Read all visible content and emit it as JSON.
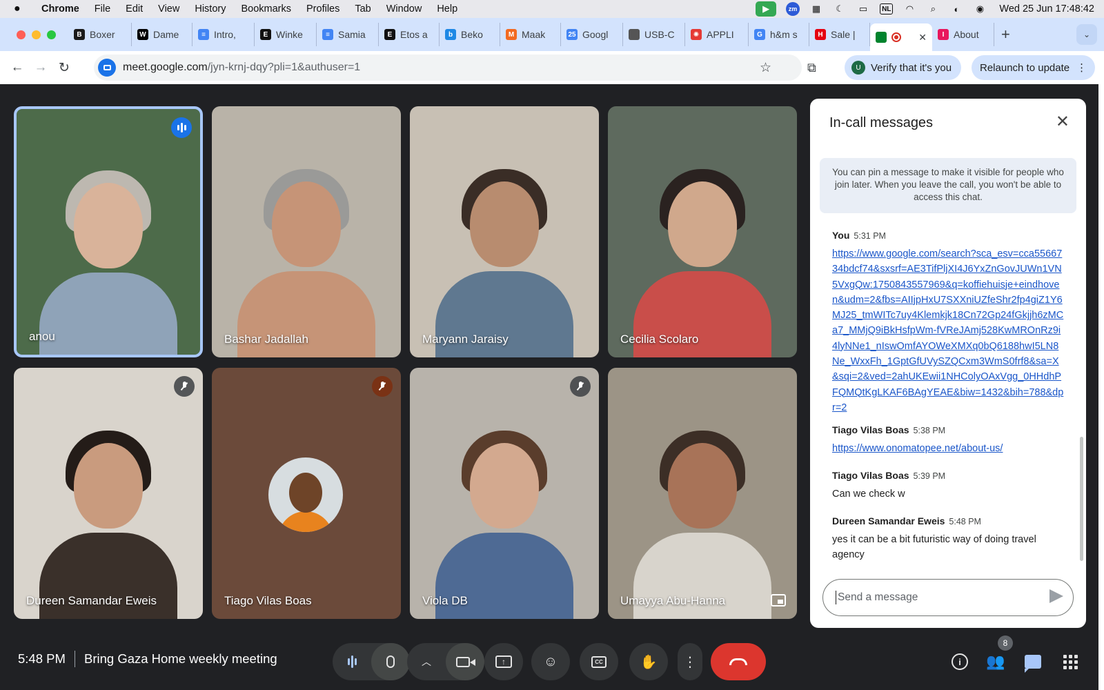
{
  "menubar": {
    "apple": "",
    "app": "Chrome",
    "items": [
      "File",
      "Edit",
      "View",
      "History",
      "Bookmarks",
      "Profiles",
      "Tab",
      "Window",
      "Help"
    ],
    "lang": "NL",
    "datetime": "Wed 25 Jun  17:48:42"
  },
  "tabs": [
    {
      "label": "Boxer",
      "fav_text": "B",
      "fav_color": "#1a1a1a",
      "icon": "boxer-icon"
    },
    {
      "label": "Dame",
      "fav_text": "W",
      "fav_color": "#000000",
      "icon": "wikipedia-icon"
    },
    {
      "label": "Intro,",
      "fav_text": "≡",
      "fav_color": "#4285f4",
      "icon": "google-docs-icon"
    },
    {
      "label": "Winke",
      "fav_text": "E",
      "fav_color": "#111111",
      "icon": "etsy-icon"
    },
    {
      "label": "Samia",
      "fav_text": "≡",
      "fav_color": "#4285f4",
      "icon": "google-docs-icon"
    },
    {
      "label": "Etos a",
      "fav_text": "E",
      "fav_color": "#111111",
      "icon": "etos-icon"
    },
    {
      "label": "Beko",
      "fav_text": "b",
      "fav_color": "#1e88e5",
      "icon": "beko-icon"
    },
    {
      "label": "Maak",
      "fav_text": "M",
      "fav_color": "#f26a21",
      "icon": "maak-icon"
    },
    {
      "label": "Googl",
      "fav_text": "25",
      "fav_color": "#4285f4",
      "icon": "google-calendar-icon"
    },
    {
      "label": "USB-C",
      "fav_text": "",
      "fav_color": "#555555",
      "icon": "apple-icon"
    },
    {
      "label": "APPLI",
      "fav_text": "✺",
      "fav_color": "#e53935",
      "icon": "appliance-icon"
    },
    {
      "label": "h&m s",
      "fav_text": "G",
      "fav_color": "#4285f4",
      "icon": "google-icon"
    },
    {
      "label": "Sale |",
      "fav_text": "H",
      "fav_color": "#e50010",
      "icon": "hm-icon"
    },
    {
      "label": "",
      "fav_text": "",
      "fav_color": "#00832d",
      "icon": "google-meet-icon",
      "active": true
    },
    {
      "label": "About",
      "fav_text": "I",
      "fav_color": "#e8175d",
      "icon": "about-icon"
    }
  ],
  "address": {
    "host": "meet.google.com",
    "path": "/jyn-krnj-dqy?pli=1&authuser=1",
    "verify": "Verify that it's you",
    "verify_badge": "U",
    "relaunch": "Relaunch to update"
  },
  "participants": [
    {
      "name": "anou",
      "bg": "#4d6b4a",
      "skin": "#d9b39a",
      "hair": "#bdb8b0",
      "shirt": "#8fa3b8",
      "status": "speaking"
    },
    {
      "name": "Bashar Jadallah",
      "bg": "#b9b3a8",
      "skin": "#c69477",
      "hair": "#9a9a98",
      "shirt": "#c69477",
      "status": "none"
    },
    {
      "name": "Maryann Jaraisy",
      "bg": "#c8c0b4",
      "skin": "#b88c6f",
      "hair": "#3a2d26",
      "shirt": "#5f7890",
      "status": "none"
    },
    {
      "name": "Cecilia Scolaro",
      "bg": "#5e6a5e",
      "skin": "#d0a88c",
      "hair": "#2a2220",
      "shirt": "#c94e4a",
      "status": "none"
    },
    {
      "name": "Dureen Samandar Eweis",
      "bg": "#d9d4cc",
      "skin": "#c99b7e",
      "hair": "#241c18",
      "shirt": "#3a302a",
      "status": "muted"
    },
    {
      "name": "Tiago Vilas Boas",
      "bg": "#6b4a3a",
      "status": "muted-orange",
      "avatar": true
    },
    {
      "name": "Viola DB",
      "bg": "#b8b3ab",
      "skin": "#d3a98f",
      "hair": "#5a3d2c",
      "shirt": "#4e6a94",
      "status": "muted"
    },
    {
      "name": "Umayya Abu-Hanna",
      "bg": "#9c9486",
      "skin": "#a87358",
      "hair": "#3c2e26",
      "shirt": "#d8d4cc",
      "status": "pip"
    }
  ],
  "chat": {
    "title": "In-call messages",
    "notice": "You can pin a message to make it visible for people who join later. When you leave the call, you won't be able to access this chat.",
    "messages": [
      {
        "sender": "You",
        "time": "5:31 PM",
        "link": "https://www.google.com/search?sca_esv=cca5566734bdcf74&sxsrf=AE3TifPljXI4J6YxZnGovJUWn1VN5VxgQw:1750843557969&q=koffiehuisje+eindhoven&udm=2&fbs=AIIjpHxU7SXXniUZfeShr2fp4giZ1Y6MJ25_tmWITc7uy4Klemkjk18Cn72Gp24fGkjjh6zMCa7_MMjQ9iBkHsfpWm-fVReJAmj528KwMROnRz9i4lyNNe1_nIswOmfAYOWeXMXq0bQ6188hwI5LN8Ne_WxxFh_1GptGfUVySZQCxm3WmS0frf8&sa=X&sqi=2&ved=2ahUKEwii1NHColyOAxVgg_0HHdhPFQMQtKgLKAF6BAgYEAE&biw=1432&bih=788&dpr=2",
        "text": ""
      },
      {
        "sender": "Tiago Vilas Boas",
        "time": "5:38 PM",
        "link": "https://www.onomatopee.net/about-us/",
        "text": ""
      },
      {
        "sender": "Tiago Vilas Boas",
        "time": "5:39 PM",
        "link": "",
        "text": "Can we check w"
      },
      {
        "sender": "Dureen Samandar Eweis",
        "time": "5:48 PM",
        "link": "",
        "text": "yes it can be a bit futuristic way of doing travel agency"
      }
    ],
    "input_placeholder": "Send a message"
  },
  "bottombar": {
    "time": "5:48 PM",
    "meeting_title": "Bring Gaza Home weekly meeting",
    "people_count": "8"
  }
}
